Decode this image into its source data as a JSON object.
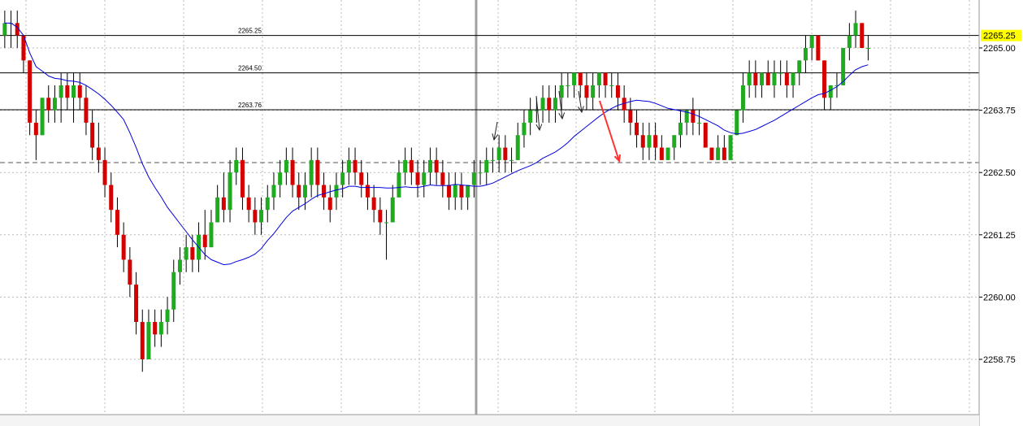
{
  "chart_data": {
    "type": "candlestick",
    "ylim": [
      2258.0,
      2266.0
    ],
    "y_ticks": [
      "2265.00",
      "2263.75",
      "2262.50",
      "2261.25",
      "2260.00",
      "2258.75"
    ],
    "y_tick_values": [
      2265.0,
      2263.75,
      2262.5,
      2261.25,
      2260.0,
      2258.75
    ],
    "current_price": {
      "label": "2265.25",
      "value": 2265.25,
      "color": "#ffff00"
    },
    "levels": [
      {
        "label": "2265.25",
        "value": 2265.25
      },
      {
        "label": "2264.50",
        "value": 2264.5
      },
      {
        "label": "2263.76",
        "value": 2263.76
      }
    ],
    "dashed_level": 2262.7,
    "grid": true,
    "colors": {
      "up": "#1faa1f",
      "down": "#d40000",
      "ma": "#0000dd",
      "arrow": "#ff3333",
      "level": "#000000"
    },
    "candles": [
      [
        2265.25,
        2265.75,
        2265.0,
        2265.5
      ],
      [
        2265.5,
        2265.75,
        2265.0,
        2265.5
      ],
      [
        2265.5,
        2265.75,
        2265.0,
        2265.25
      ],
      [
        2265.25,
        2265.25,
        2264.5,
        2264.75
      ],
      [
        2264.75,
        2264.75,
        2263.25,
        2263.5
      ],
      [
        2263.5,
        2263.75,
        2262.75,
        2263.25
      ],
      [
        2263.25,
        2264.0,
        2263.25,
        2264.0
      ],
      [
        2264.0,
        2264.25,
        2263.5,
        2263.75
      ],
      [
        2263.75,
        2264.25,
        2263.5,
        2264.0
      ],
      [
        2264.0,
        2264.5,
        2263.5,
        2264.25
      ],
      [
        2264.25,
        2264.5,
        2263.75,
        2264.0
      ],
      [
        2264.0,
        2264.5,
        2263.5,
        2264.25
      ],
      [
        2264.25,
        2264.5,
        2263.75,
        2264.0
      ],
      [
        2264.0,
        2264.25,
        2263.25,
        2263.5
      ],
      [
        2263.5,
        2263.75,
        2262.75,
        2263.0
      ],
      [
        2263.0,
        2263.5,
        2262.5,
        2262.75
      ],
      [
        2262.75,
        2263.0,
        2262.0,
        2262.25
      ],
      [
        2262.25,
        2262.5,
        2261.5,
        2261.75
      ],
      [
        2261.75,
        2262.0,
        2261.0,
        2261.25
      ],
      [
        2261.25,
        2261.5,
        2260.5,
        2260.75
      ],
      [
        2260.75,
        2261.0,
        2260.0,
        2260.25
      ],
      [
        2260.25,
        2260.5,
        2259.25,
        2259.5
      ],
      [
        2259.5,
        2259.75,
        2258.5,
        2258.75
      ],
      [
        2258.75,
        2259.75,
        2258.75,
        2259.5
      ],
      [
        2259.5,
        2259.75,
        2259.0,
        2259.25
      ],
      [
        2259.25,
        2259.75,
        2259.0,
        2259.5
      ],
      [
        2259.5,
        2260.0,
        2259.25,
        2259.75
      ],
      [
        2259.75,
        2260.75,
        2259.5,
        2260.5
      ],
      [
        2260.5,
        2261.0,
        2260.25,
        2260.75
      ],
      [
        2260.75,
        2261.25,
        2260.5,
        2261.0
      ],
      [
        2261.0,
        2261.25,
        2260.5,
        2260.75
      ],
      [
        2260.75,
        2261.5,
        2260.5,
        2261.25
      ],
      [
        2261.25,
        2261.75,
        2260.75,
        2261.0
      ],
      [
        2261.0,
        2261.75,
        2261.0,
        2261.5
      ],
      [
        2261.5,
        2262.25,
        2261.5,
        2262.0
      ],
      [
        2262.0,
        2262.5,
        2261.5,
        2261.75
      ],
      [
        2261.75,
        2262.75,
        2261.5,
        2262.5
      ],
      [
        2262.5,
        2263.0,
        2262.25,
        2262.75
      ],
      [
        2262.75,
        2263.0,
        2261.75,
        2262.0
      ],
      [
        2262.0,
        2262.25,
        2261.5,
        2261.75
      ],
      [
        2261.75,
        2262.0,
        2261.25,
        2261.5
      ],
      [
        2261.5,
        2262.0,
        2261.25,
        2261.75
      ],
      [
        2261.75,
        2262.25,
        2261.5,
        2262.0
      ],
      [
        2262.0,
        2262.5,
        2261.75,
        2262.25
      ],
      [
        2262.25,
        2262.75,
        2262.0,
        2262.5
      ],
      [
        2262.5,
        2263.0,
        2262.25,
        2262.75
      ],
      [
        2262.75,
        2263.0,
        2262.0,
        2262.25
      ],
      [
        2262.25,
        2262.5,
        2261.75,
        2262.0
      ],
      [
        2262.0,
        2262.5,
        2261.75,
        2262.25
      ],
      [
        2262.25,
        2263.0,
        2262.0,
        2262.75
      ],
      [
        2262.75,
        2263.0,
        2262.0,
        2262.25
      ],
      [
        2262.25,
        2262.5,
        2261.75,
        2262.0
      ],
      [
        2262.0,
        2262.25,
        2261.5,
        2261.75
      ],
      [
        2262.0,
        2262.5,
        2261.75,
        2262.25
      ],
      [
        2262.25,
        2262.75,
        2262.0,
        2262.5
      ],
      [
        2262.5,
        2263.0,
        2262.25,
        2262.75
      ],
      [
        2262.75,
        2263.0,
        2262.25,
        2262.5
      ],
      [
        2262.5,
        2262.75,
        2262.0,
        2262.25
      ],
      [
        2262.25,
        2262.5,
        2261.75,
        2262.0
      ],
      [
        2262.0,
        2262.25,
        2261.5,
        2261.75
      ],
      [
        2261.75,
        2262.0,
        2261.25,
        2261.5
      ],
      [
        2261.5,
        2261.75,
        2260.75,
        2261.5
      ],
      [
        2261.5,
        2262.25,
        2261.5,
        2262.0
      ],
      [
        2262.0,
        2262.75,
        2262.0,
        2262.5
      ],
      [
        2262.5,
        2263.0,
        2262.25,
        2262.75
      ],
      [
        2262.75,
        2263.0,
        2262.25,
        2262.5
      ],
      [
        2262.5,
        2262.75,
        2262.0,
        2262.25
      ],
      [
        2262.25,
        2262.75,
        2262.0,
        2262.5
      ],
      [
        2262.5,
        2263.0,
        2262.25,
        2262.75
      ],
      [
        2262.75,
        2263.0,
        2262.25,
        2262.5
      ],
      [
        2262.5,
        2262.75,
        2262.0,
        2262.25
      ],
      [
        2262.25,
        2262.5,
        2261.75,
        2262.0
      ],
      [
        2262.0,
        2262.5,
        2261.75,
        2262.25
      ],
      [
        2262.25,
        2262.5,
        2261.75,
        2262.0
      ],
      [
        2262.0,
        2262.25,
        2261.75,
        2262.25
      ],
      [
        2262.25,
        2262.75,
        2262.0,
        2262.5
      ],
      [
        2262.5,
        2262.75,
        2262.25,
        2262.5
      ],
      [
        2262.5,
        2263.0,
        2262.25,
        2262.75
      ],
      [
        2262.75,
        2263.0,
        2262.5,
        2262.75
      ],
      [
        2262.75,
        2263.25,
        2262.5,
        2263.0
      ],
      [
        2263.0,
        2263.25,
        2262.5,
        2262.75
      ],
      [
        2262.75,
        2263.0,
        2262.5,
        2262.75
      ],
      [
        2262.75,
        2263.5,
        2262.75,
        2263.25
      ],
      [
        2263.25,
        2263.75,
        2263.0,
        2263.5
      ],
      [
        2263.5,
        2264.0,
        2263.25,
        2263.75
      ],
      [
        2263.75,
        2264.0,
        2263.5,
        2263.75
      ],
      [
        2263.75,
        2264.25,
        2263.5,
        2264.0
      ],
      [
        2264.0,
        2264.25,
        2263.5,
        2263.75
      ],
      [
        2263.75,
        2264.25,
        2263.5,
        2264.0
      ],
      [
        2264.0,
        2264.5,
        2263.75,
        2264.25
      ],
      [
        2264.25,
        2264.5,
        2264.0,
        2264.25
      ],
      [
        2264.25,
        2264.5,
        2264.0,
        2264.5
      ],
      [
        2264.5,
        2264.5,
        2264.0,
        2264.25
      ],
      [
        2264.25,
        2264.5,
        2263.75,
        2264.0
      ],
      [
        2264.0,
        2264.5,
        2263.75,
        2264.25
      ],
      [
        2264.25,
        2264.5,
        2264.0,
        2264.5
      ],
      [
        2264.5,
        2264.5,
        2264.0,
        2264.25
      ],
      [
        2264.25,
        2264.5,
        2264.0,
        2264.25
      ],
      [
        2264.25,
        2264.5,
        2263.75,
        2264.0
      ],
      [
        2264.0,
        2264.25,
        2263.5,
        2263.75
      ],
      [
        2263.75,
        2264.0,
        2263.25,
        2263.5
      ],
      [
        2263.5,
        2263.75,
        2263.0,
        2263.25
      ],
      [
        2263.25,
        2263.5,
        2262.75,
        2263.0
      ],
      [
        2263.0,
        2263.5,
        2262.75,
        2263.25
      ],
      [
        2263.25,
        2263.5,
        2262.75,
        2263.0
      ],
      [
        2263.0,
        2263.25,
        2262.75,
        2262.75
      ],
      [
        2262.75,
        2263.0,
        2262.75,
        2263.0
      ],
      [
        2263.0,
        2263.25,
        2262.75,
        2263.25
      ],
      [
        2263.25,
        2263.75,
        2263.0,
        2263.5
      ],
      [
        2263.5,
        2263.75,
        2263.25,
        2263.75
      ],
      [
        2263.75,
        2264.0,
        2263.25,
        2263.5
      ],
      [
        2263.5,
        2263.75,
        2263.25,
        2263.5
      ],
      [
        2263.5,
        2263.5,
        2263.0,
        2263.0
      ],
      [
        2263.0,
        2263.0,
        2262.75,
        2262.75
      ],
      [
        2262.75,
        2263.25,
        2262.75,
        2263.0
      ],
      [
        2263.0,
        2263.25,
        2262.75,
        2262.75
      ],
      [
        2262.75,
        2263.25,
        2262.75,
        2263.25
      ],
      [
        2263.25,
        2263.75,
        2263.25,
        2263.75
      ],
      [
        2263.75,
        2264.5,
        2263.5,
        2264.25
      ],
      [
        2264.25,
        2264.75,
        2264.0,
        2264.5
      ],
      [
        2264.5,
        2264.75,
        2264.0,
        2264.25
      ],
      [
        2264.25,
        2264.5,
        2264.0,
        2264.5
      ],
      [
        2264.5,
        2264.75,
        2264.25,
        2264.25
      ],
      [
        2264.25,
        2264.75,
        2264.0,
        2264.5
      ],
      [
        2264.5,
        2264.75,
        2264.25,
        2264.5
      ],
      [
        2264.5,
        2264.75,
        2264.0,
        2264.25
      ],
      [
        2264.25,
        2264.5,
        2264.0,
        2264.5
      ],
      [
        2264.5,
        2264.75,
        2264.25,
        2264.75
      ],
      [
        2264.75,
        2265.25,
        2264.5,
        2265.0
      ],
      [
        2265.0,
        2265.25,
        2264.75,
        2265.25
      ],
      [
        2265.25,
        2265.25,
        2264.75,
        2264.75
      ],
      [
        2264.75,
        2264.75,
        2263.75,
        2264.0
      ],
      [
        2264.0,
        2264.25,
        2263.75,
        2264.25
      ],
      [
        2264.25,
        2264.5,
        2264.0,
        2264.25
      ],
      [
        2264.25,
        2265.0,
        2264.25,
        2265.0
      ],
      [
        2265.0,
        2265.5,
        2264.75,
        2265.25
      ],
      [
        2265.25,
        2265.75,
        2265.0,
        2265.5
      ],
      [
        2265.5,
        2265.5,
        2265.0,
        2265.0
      ],
      [
        2265.0,
        2265.25,
        2264.75,
        2265.0
      ]
    ],
    "ma_period": 20
  }
}
